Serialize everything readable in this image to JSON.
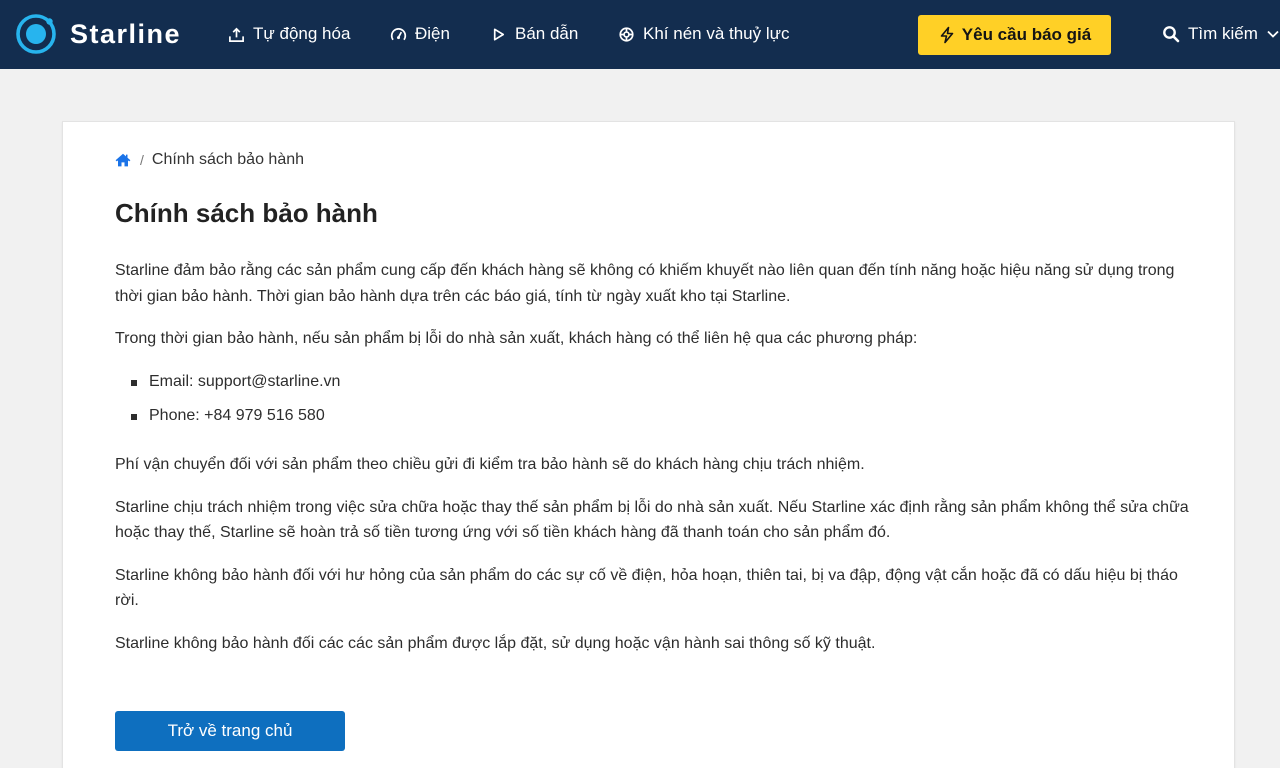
{
  "header": {
    "brand": "Starline",
    "nav": [
      {
        "label": "Tự động hóa",
        "icon": "automation-icon"
      },
      {
        "label": "Điện",
        "icon": "electric-gauge-icon"
      },
      {
        "label": "Bán dẫn",
        "icon": "play-triangle-icon"
      },
      {
        "label": "Khí nén và thuỷ lực",
        "icon": "gear-icon"
      }
    ],
    "quote_button": "Yêu cầu báo giá",
    "search_label": "Tìm kiếm"
  },
  "breadcrumb": {
    "current": "Chính sách bảo hành"
  },
  "page": {
    "title": "Chính sách bảo hành",
    "paragraphs": [
      "Starline đảm bảo rằng các sản phẩm cung cấp đến khách hàng sẽ không có khiếm khuyết nào liên quan đến tính năng hoặc hiệu năng sử dụng trong thời gian bảo hành. Thời gian bảo hành dựa trên các báo giá, tính từ ngày xuất kho tại Starline.",
      "Trong thời gian bảo hành, nếu sản phẩm bị lỗi do nhà sản xuất, khách hàng có thể liên hệ qua các phương pháp:",
      "Phí vận chuyển đối với sản phẩm theo chiều gửi đi kiểm tra bảo hành sẽ do khách hàng chịu trách nhiệm.",
      "Starline chịu trách nhiệm trong việc sửa chữa hoặc thay thế sản phẩm bị lỗi do nhà sản xuất. Nếu Starline xác định rằng sản phẩm không thể sửa chữa hoặc thay thế, Starline sẽ hoàn trả số tiền tương ứng với số tiền khách hàng đã thanh toán cho sản phẩm đó.",
      "Starline không bảo hành đối với hư hỏng của sản phẩm do các sự cố về điện, hỏa hoạn, thiên tai, bị va đập, động vật cắn hoặc đã có dấu hiệu bị tháo rời.",
      "Starline không bảo hành đối các các sản phẩm được lắp đặt, sử dụng hoặc vận hành sai thông số kỹ thuật."
    ],
    "contacts": [
      "Email: support@starline.vn",
      "Phone: +84 979 516 580"
    ],
    "home_button": "Trở về trang chủ"
  },
  "colors": {
    "header_bg": "#132d4f",
    "accent_yellow": "#ffd026",
    "primary_blue": "#0e6fbf",
    "logo_cyan": "#27b4ee",
    "page_bg": "#f1f1f1"
  }
}
